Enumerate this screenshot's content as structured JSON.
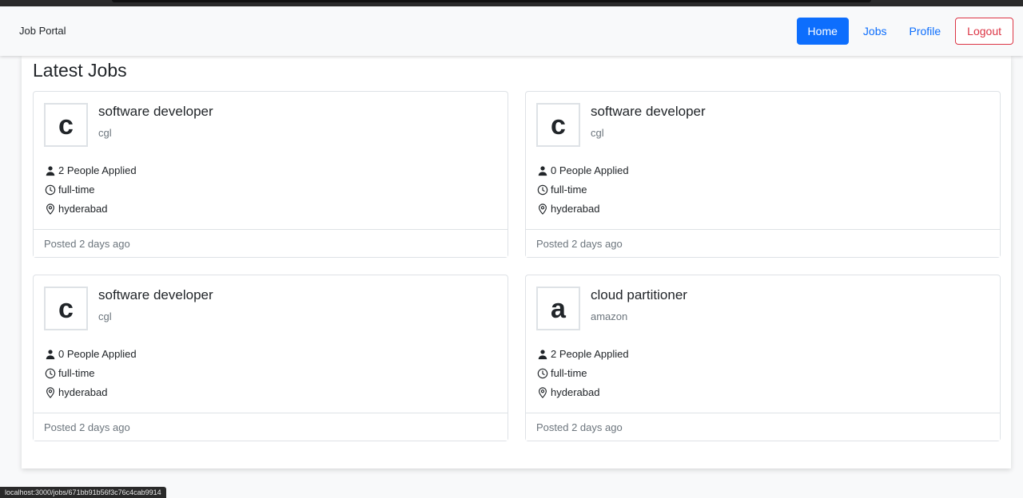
{
  "nav": {
    "brand": "Job Portal",
    "home": "Home",
    "jobs": "Jobs",
    "profile": "Profile",
    "logout": "Logout"
  },
  "page_title": "Latest Jobs",
  "jobs": [
    {
      "initial": "c",
      "title": "software developer",
      "company": "cgl",
      "applied": "2 People Applied",
      "type": "full-time",
      "location": "hyderabad",
      "posted": "Posted 2 days ago"
    },
    {
      "initial": "c",
      "title": "software developer",
      "company": "cgl",
      "applied": "0 People Applied",
      "type": "full-time",
      "location": "hyderabad",
      "posted": "Posted 2 days ago"
    },
    {
      "initial": "c",
      "title": "software developer",
      "company": "cgl",
      "applied": "0 People Applied",
      "type": "full-time",
      "location": "hyderabad",
      "posted": "Posted 2 days ago"
    },
    {
      "initial": "a",
      "title": "cloud partitioner",
      "company": "amazon",
      "applied": "2 People Applied",
      "type": "full-time",
      "location": "hyderabad",
      "posted": "Posted 2 days ago"
    }
  ],
  "icons": {
    "applied": "person-icon",
    "type": "clock-icon",
    "location": "map-pin-icon"
  },
  "colors": {
    "primary": "#0d6efd",
    "danger": "#dc3545",
    "muted": "#6c757d"
  },
  "status_url": "localhost:3000/jobs/671bb91b56f3c76c4cab9914"
}
